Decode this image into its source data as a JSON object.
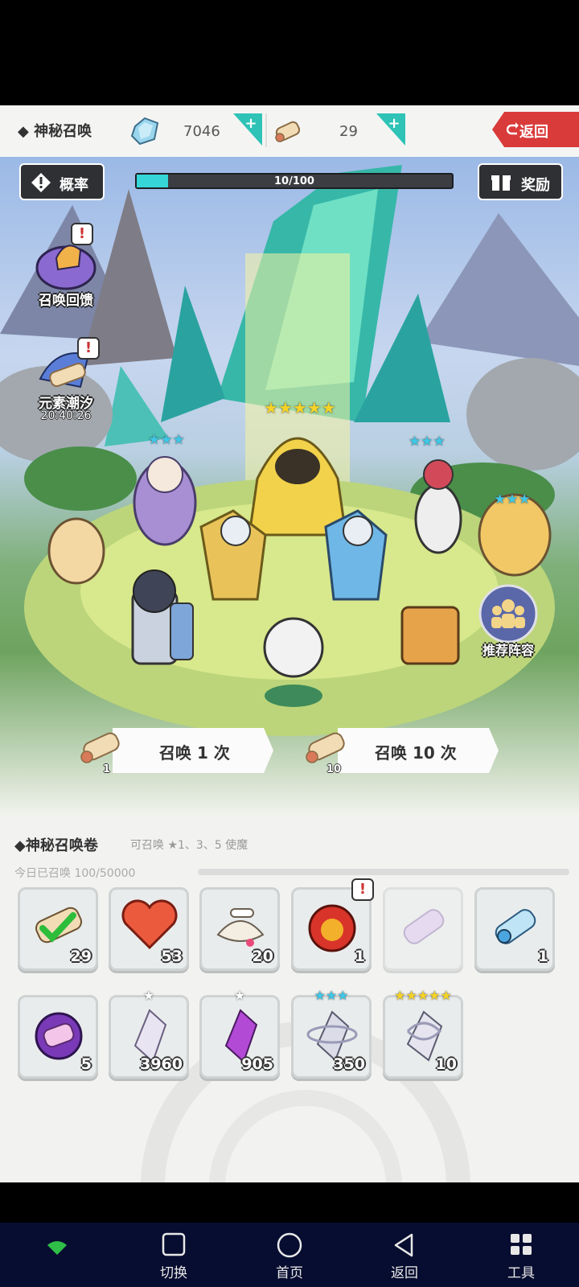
{
  "header": {
    "title": "◆ 神秘召唤",
    "gems": "7046",
    "scrolls": "29",
    "back_label": "返回"
  },
  "scene": {
    "prob_label": "概率",
    "reward_label": "奖励",
    "progress_text": "10/100",
    "progress": 0.1,
    "side_icons": [
      {
        "label": "召唤回馈"
      },
      {
        "label": "元素潮汐",
        "timer": "20:40:26"
      }
    ],
    "recommend_label": "推荐阵容",
    "summon_once_label": "召唤 1 次",
    "summon_once_cost": "1",
    "summon_ten_label": "召唤 10 次",
    "summon_ten_cost": "10",
    "featured_stars": "★★★★★",
    "three_stars": "★★★"
  },
  "panel": {
    "title": "◆神秘召唤卷",
    "desc": "可召唤 ★1、3、5 使魔",
    "summoned": "今日已召唤 100/50000",
    "items_row1": [
      {
        "name": "item-green-check-scroll",
        "count": "29"
      },
      {
        "name": "item-heart",
        "count": "53"
      },
      {
        "name": "item-bone-shell",
        "count": "20"
      },
      {
        "name": "item-flame-orb",
        "count": "1"
      },
      {
        "name": "item-purple-scroll",
        "count": ""
      },
      {
        "name": "item-blue-scroll",
        "count": "1"
      }
    ],
    "items_row2": [
      {
        "name": "item-purple-tome",
        "count": "5"
      },
      {
        "name": "item-white-crystal",
        "count": "3960",
        "stars": "★"
      },
      {
        "name": "item-purple-crystal",
        "count": "905",
        "stars": "★"
      },
      {
        "name": "item-silver-ring-crystal",
        "count": "350",
        "stars": "★★★"
      },
      {
        "name": "item-gold-crystal",
        "count": "10",
        "stars": "★★★★★"
      }
    ]
  },
  "navbar": {
    "switch": "切换",
    "home": "首页",
    "back": "返回",
    "tools": "工具"
  },
  "colors": {
    "accent_cyan": "#35d5d8",
    "back_red": "#d93a3a",
    "nav_bg": "#070d30"
  }
}
